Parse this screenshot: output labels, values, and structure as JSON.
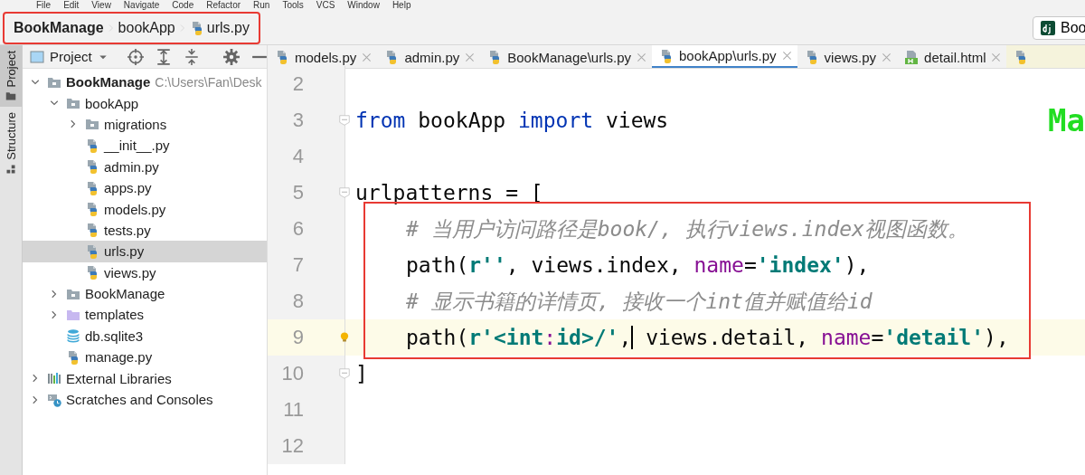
{
  "menu": [
    "File",
    "Edit",
    "View",
    "Navigate",
    "Code",
    "Refactor",
    "Run",
    "Tools",
    "VCS",
    "Window",
    "Help"
  ],
  "breadcrumb": [
    {
      "label": "BookManage",
      "kind": "project"
    },
    {
      "label": "bookApp",
      "kind": "folder"
    },
    {
      "label": "urls.py",
      "kind": "python"
    }
  ],
  "run_config": {
    "label": "Boo"
  },
  "side_tabs": [
    {
      "label": "Project",
      "selected": true
    },
    {
      "label": "Structure",
      "selected": false
    }
  ],
  "project_panel": {
    "title": "Project",
    "tree": [
      {
        "label": "BookManage",
        "detail": "C:\\Users\\Fan\\Desk",
        "kind": "folder",
        "expanded": true,
        "selected": false,
        "children": [
          {
            "label": "bookApp",
            "kind": "folder",
            "expanded": true,
            "selected": false,
            "children": [
              {
                "label": "migrations",
                "kind": "folder",
                "expanded": false,
                "selected": false
              },
              {
                "label": "__init__.py",
                "kind": "python",
                "selected": false
              },
              {
                "label": "admin.py",
                "kind": "python",
                "selected": false
              },
              {
                "label": "apps.py",
                "kind": "python",
                "selected": false
              },
              {
                "label": "models.py",
                "kind": "python",
                "selected": false
              },
              {
                "label": "tests.py",
                "kind": "python",
                "selected": false
              },
              {
                "label": "urls.py",
                "kind": "python",
                "selected": true
              },
              {
                "label": "views.py",
                "kind": "python",
                "selected": false
              }
            ]
          },
          {
            "label": "BookManage",
            "kind": "folder",
            "expanded": false,
            "selected": false
          },
          {
            "label": "templates",
            "kind": "templates",
            "expanded": false,
            "selected": false
          },
          {
            "label": "db.sqlite3",
            "kind": "database",
            "selected": false
          },
          {
            "label": "manage.py",
            "kind": "python",
            "selected": false
          }
        ]
      },
      {
        "label": "External Libraries",
        "kind": "libraries",
        "expanded": false,
        "selected": false
      },
      {
        "label": "Scratches and Consoles",
        "kind": "scratches",
        "expanded": false,
        "selected": false
      }
    ]
  },
  "editor_tabs": [
    {
      "label": "models.py",
      "kind": "python",
      "selected": false
    },
    {
      "label": "admin.py",
      "kind": "python",
      "selected": false
    },
    {
      "label": "BookManage\\urls.py",
      "kind": "python",
      "selected": false
    },
    {
      "label": "bookApp\\urls.py",
      "kind": "python",
      "selected": true
    },
    {
      "label": "views.py",
      "kind": "python",
      "selected": false
    },
    {
      "label": "detail.html",
      "kind": "html",
      "selected": false
    },
    {
      "kind": "python",
      "selected": false
    }
  ],
  "editor": {
    "overlay_text": "Ma",
    "lines": [
      {
        "number": "2",
        "fold": false,
        "current": false
      },
      {
        "number": "3",
        "fold": true,
        "current": false,
        "indented": false,
        "tokens": [
          {
            "text": "from",
            "kind": "keyword"
          },
          {
            "text": " bookApp ",
            "kind": "plain"
          },
          {
            "text": "import",
            "kind": "keyword"
          },
          {
            "text": " views",
            "kind": "plain"
          }
        ]
      },
      {
        "number": "4",
        "fold": false,
        "current": false
      },
      {
        "number": "5",
        "fold": true,
        "current": false,
        "indented": false,
        "tokens": [
          {
            "text": "urlpatterns = [",
            "kind": "plain"
          }
        ]
      },
      {
        "number": "6",
        "fold": false,
        "current": false,
        "indented": true,
        "tokens": [
          {
            "text": "# 当用户访问路径是book/, 执行views.index视图函数。",
            "kind": "comment"
          }
        ]
      },
      {
        "number": "7",
        "fold": false,
        "current": false,
        "indented": true,
        "tokens": [
          {
            "text": "path(",
            "kind": "plain"
          },
          {
            "text": "r''",
            "kind": "string"
          },
          {
            "text": ", views.index, ",
            "kind": "plain"
          },
          {
            "text": "name",
            "kind": "param"
          },
          {
            "text": "=",
            "kind": "plain"
          },
          {
            "text": "'index'",
            "kind": "string"
          },
          {
            "text": "),",
            "kind": "plain"
          }
        ]
      },
      {
        "number": "8",
        "fold": false,
        "current": false,
        "indented": true,
        "tokens": [
          {
            "text": "# 显示书籍的详情页, 接收一个int值并赋值给id",
            "kind": "comment"
          }
        ]
      },
      {
        "number": "9",
        "fold": false,
        "current": true,
        "indented": true,
        "tokens": [
          {
            "text": "path(",
            "kind": "plain"
          },
          {
            "text": "r'<int",
            "kind": "string"
          },
          {
            "text": ":",
            "kind": "param"
          },
          {
            "text": "id>/'",
            "kind": "string"
          },
          {
            "text": ",",
            "kind": "plain",
            "cursor_after": true
          },
          {
            "text": " views.detail, ",
            "kind": "plain"
          },
          {
            "text": "name",
            "kind": "param"
          },
          {
            "text": "=",
            "kind": "plain"
          },
          {
            "text": "'detail'",
            "kind": "string"
          },
          {
            "text": "),",
            "kind": "plain"
          }
        ]
      },
      {
        "number": "10",
        "fold": true,
        "current": false,
        "indented": false,
        "tokens": [
          {
            "text": "]",
            "kind": "plain"
          }
        ]
      },
      {
        "number": "11",
        "fold": false,
        "current": false
      },
      {
        "number": "12",
        "fold": false,
        "current": false
      }
    ]
  }
}
